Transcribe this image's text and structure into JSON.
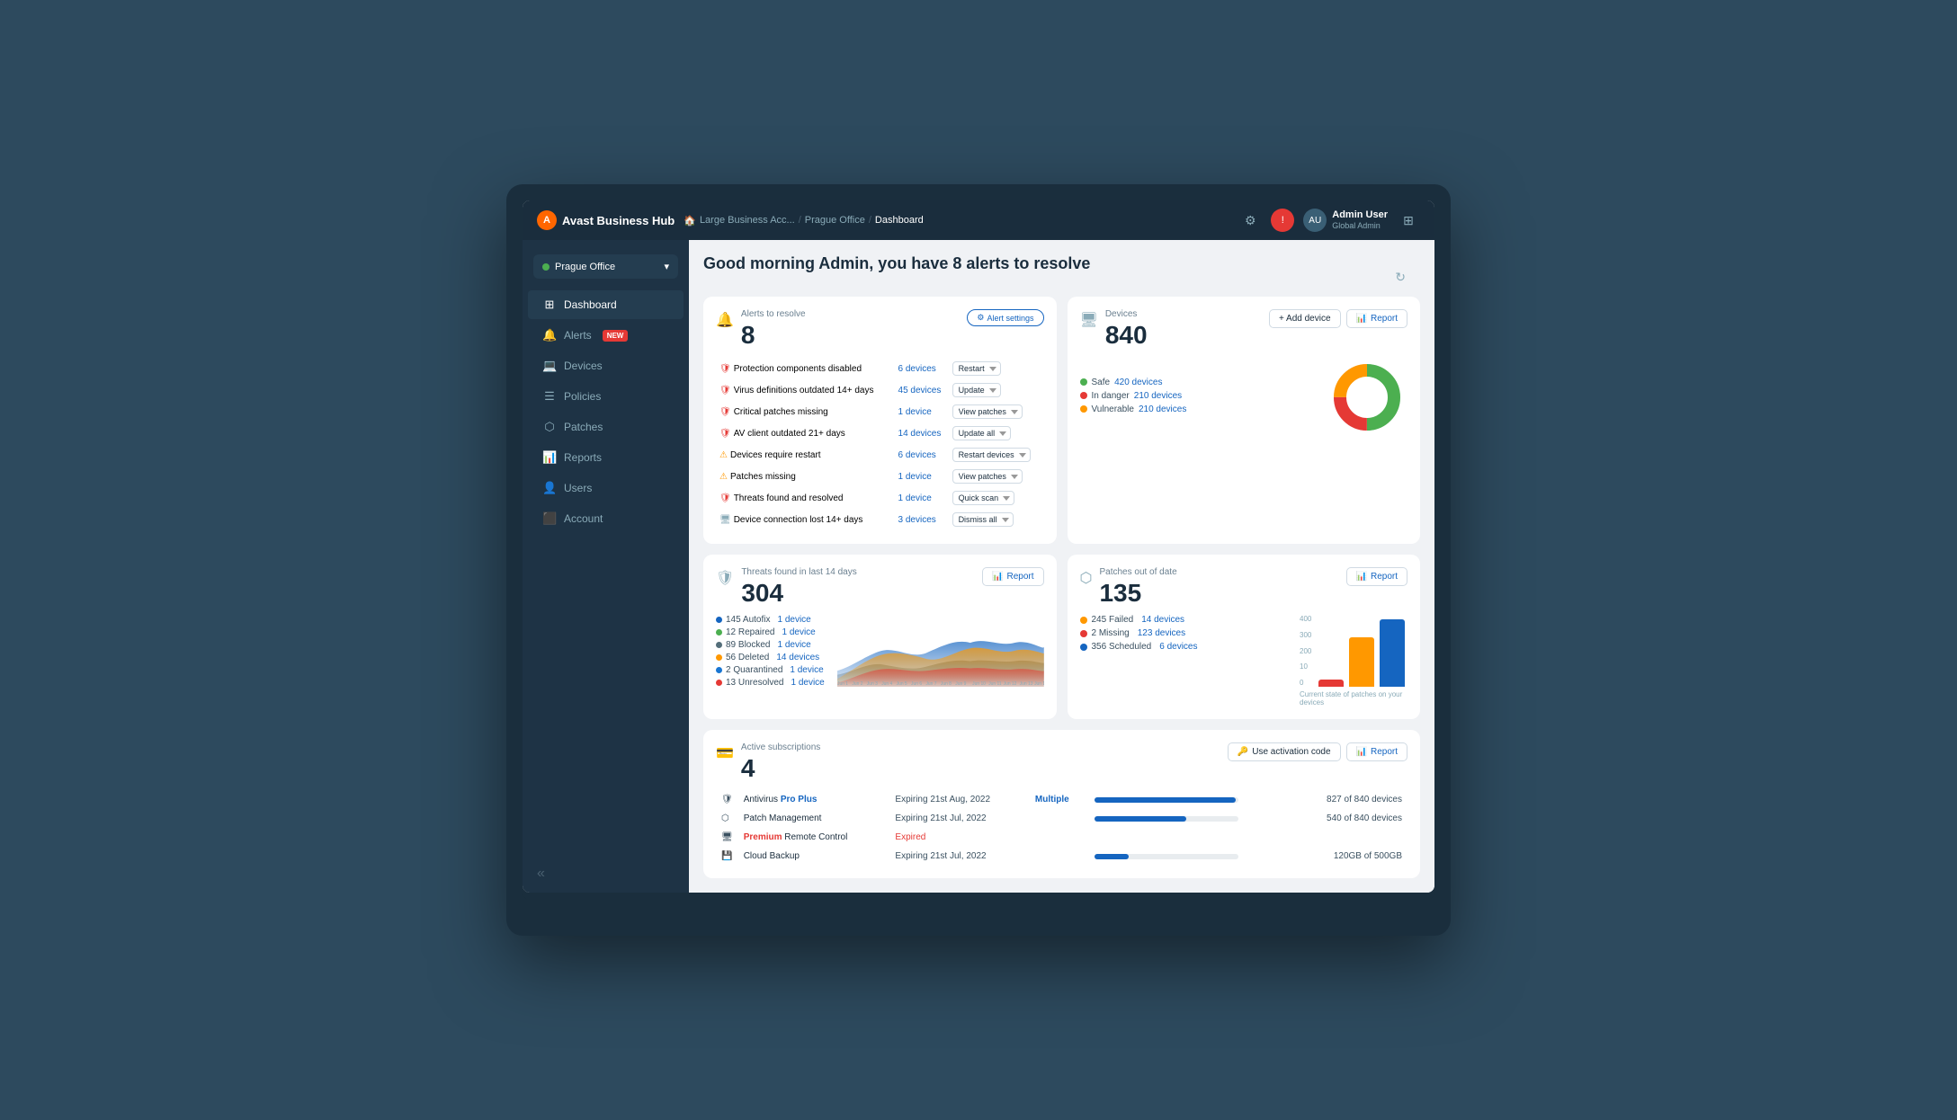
{
  "app": {
    "name": "Avast Business Hub"
  },
  "topbar": {
    "breadcrumb": [
      "Large Business Acc...",
      "Prague Office",
      "Dashboard"
    ],
    "user": {
      "name": "Admin User",
      "role": "Global Admin"
    }
  },
  "sidebar": {
    "office": "Prague Office",
    "nav": [
      {
        "label": "Dashboard",
        "icon": "⊞",
        "active": true
      },
      {
        "label": "Alerts",
        "icon": "🔔",
        "badge": "NEW"
      },
      {
        "label": "Devices",
        "icon": "💻"
      },
      {
        "label": "Policies",
        "icon": "☰"
      },
      {
        "label": "Patches",
        "icon": "⬡"
      },
      {
        "label": "Reports",
        "icon": "📊"
      },
      {
        "label": "Users",
        "icon": "👤"
      },
      {
        "label": "Account",
        "icon": "⬛"
      }
    ]
  },
  "page": {
    "title": "Good morning Admin, you have 8 alerts to resolve"
  },
  "alerts_card": {
    "label": "Alerts to resolve",
    "count": "8",
    "settings_btn": "Alert settings",
    "rows": [
      {
        "icon": "🛡",
        "status": "red",
        "text": "Protection components disabled",
        "link": "6 devices",
        "action": "Restart"
      },
      {
        "icon": "🛡",
        "status": "red",
        "text": "Virus definitions outdated 14+ days",
        "link": "45 devices",
        "action": "Update"
      },
      {
        "icon": "🛡",
        "status": "red",
        "text": "Critical patches missing",
        "link": "1 device",
        "action": "View patches"
      },
      {
        "icon": "🛡",
        "status": "red",
        "text": "AV client outdated 21+ days",
        "link": "14 devices",
        "action": "Update all"
      },
      {
        "icon": "⚠",
        "status": "orange",
        "text": "Devices require restart",
        "link": "6 devices",
        "action": "Restart devices"
      },
      {
        "icon": "⚠",
        "status": "orange",
        "text": "Patches missing",
        "link": "1 device",
        "action": "View patches"
      },
      {
        "icon": "🛡",
        "status": "red",
        "text": "Threats found and resolved",
        "link": "1 device",
        "action": "Quick scan"
      },
      {
        "icon": "🖥",
        "status": "gray",
        "text": "Device connection lost 14+ days",
        "link": "3 devices",
        "action": "Dismiss all"
      }
    ]
  },
  "devices_card": {
    "label": "Devices",
    "count": "840",
    "add_btn": "+ Add device",
    "report_btn": "Report",
    "legend": [
      {
        "color": "#4CAF50",
        "label": "Safe",
        "link": "420 devices"
      },
      {
        "color": "#e53935",
        "label": "In danger",
        "link": "210 devices"
      },
      {
        "color": "#FF9800",
        "label": "Vulnerable",
        "link": "210 devices"
      }
    ],
    "donut": {
      "safe_pct": 50,
      "danger_pct": 25,
      "vuln_pct": 25
    }
  },
  "threats_card": {
    "label": "Threats found in last 14 days",
    "count": "304",
    "report_btn": "Report",
    "items": [
      {
        "color": "#1565C0",
        "label": "145 Autofix",
        "link": "1 device"
      },
      {
        "color": "#4CAF50",
        "label": "12 Repaired",
        "link": "1 device"
      },
      {
        "color": "#546E7A",
        "label": "89 Blocked",
        "link": "1 device"
      },
      {
        "color": "#FF9800",
        "label": "56 Deleted",
        "link": "14 devices"
      },
      {
        "color": "#1976D2",
        "label": "2 Quarantined",
        "link": "1 device"
      },
      {
        "color": "#e53935",
        "label": "13 Unresolved",
        "link": "1 device"
      }
    ]
  },
  "patches_card": {
    "label": "Patches out of date",
    "count": "135",
    "report_btn": "Report",
    "legend": [
      {
        "color": "#FF9800",
        "label": "245 Failed",
        "link": "14 devices"
      },
      {
        "color": "#e53935",
        "label": "2 Missing",
        "link": "123 devices"
      },
      {
        "color": "#1565C0",
        "label": "356 Scheduled",
        "link": "6 devices"
      }
    ],
    "chart_note": "Current state of patches on your devices",
    "bars": [
      {
        "color": "#e53935",
        "height": 8,
        "label": ""
      },
      {
        "color": "#FF9800",
        "height": 55,
        "label": ""
      },
      {
        "color": "#1565C0",
        "height": 75,
        "label": ""
      }
    ],
    "y_labels": [
      "400",
      "300",
      "200",
      "10",
      "0"
    ]
  },
  "subscriptions_card": {
    "label": "Active subscriptions",
    "count": "4",
    "use_code_btn": "Use activation code",
    "report_btn": "Report",
    "rows": [
      {
        "icon": "🛡",
        "name": "Antivirus",
        "name_tag": "Pro Plus",
        "name_tag_class": "pro",
        "expiry": "Expiring 21st Aug, 2022",
        "multi": "Multiple",
        "progress": 98,
        "count": "827 of 840 devices"
      },
      {
        "icon": "⬡",
        "name": "Patch Management",
        "name_tag": "",
        "expiry": "Expiring 21st Jul, 2022",
        "multi": "",
        "progress": 64,
        "count": "540 of 840 devices"
      },
      {
        "icon": "🖥",
        "name": "",
        "name_tag": "Premium",
        "name_tag_class": "premium",
        "name_suffix": "Remote Control",
        "expiry": "Expired",
        "expiry_class": "expired",
        "multi": "",
        "progress": 0,
        "count": ""
      },
      {
        "icon": "💾",
        "name": "Cloud Backup",
        "name_tag": "",
        "expiry": "Expiring 21st Jul, 2022",
        "multi": "",
        "progress": 24,
        "count": "120GB of 500GB"
      }
    ]
  }
}
